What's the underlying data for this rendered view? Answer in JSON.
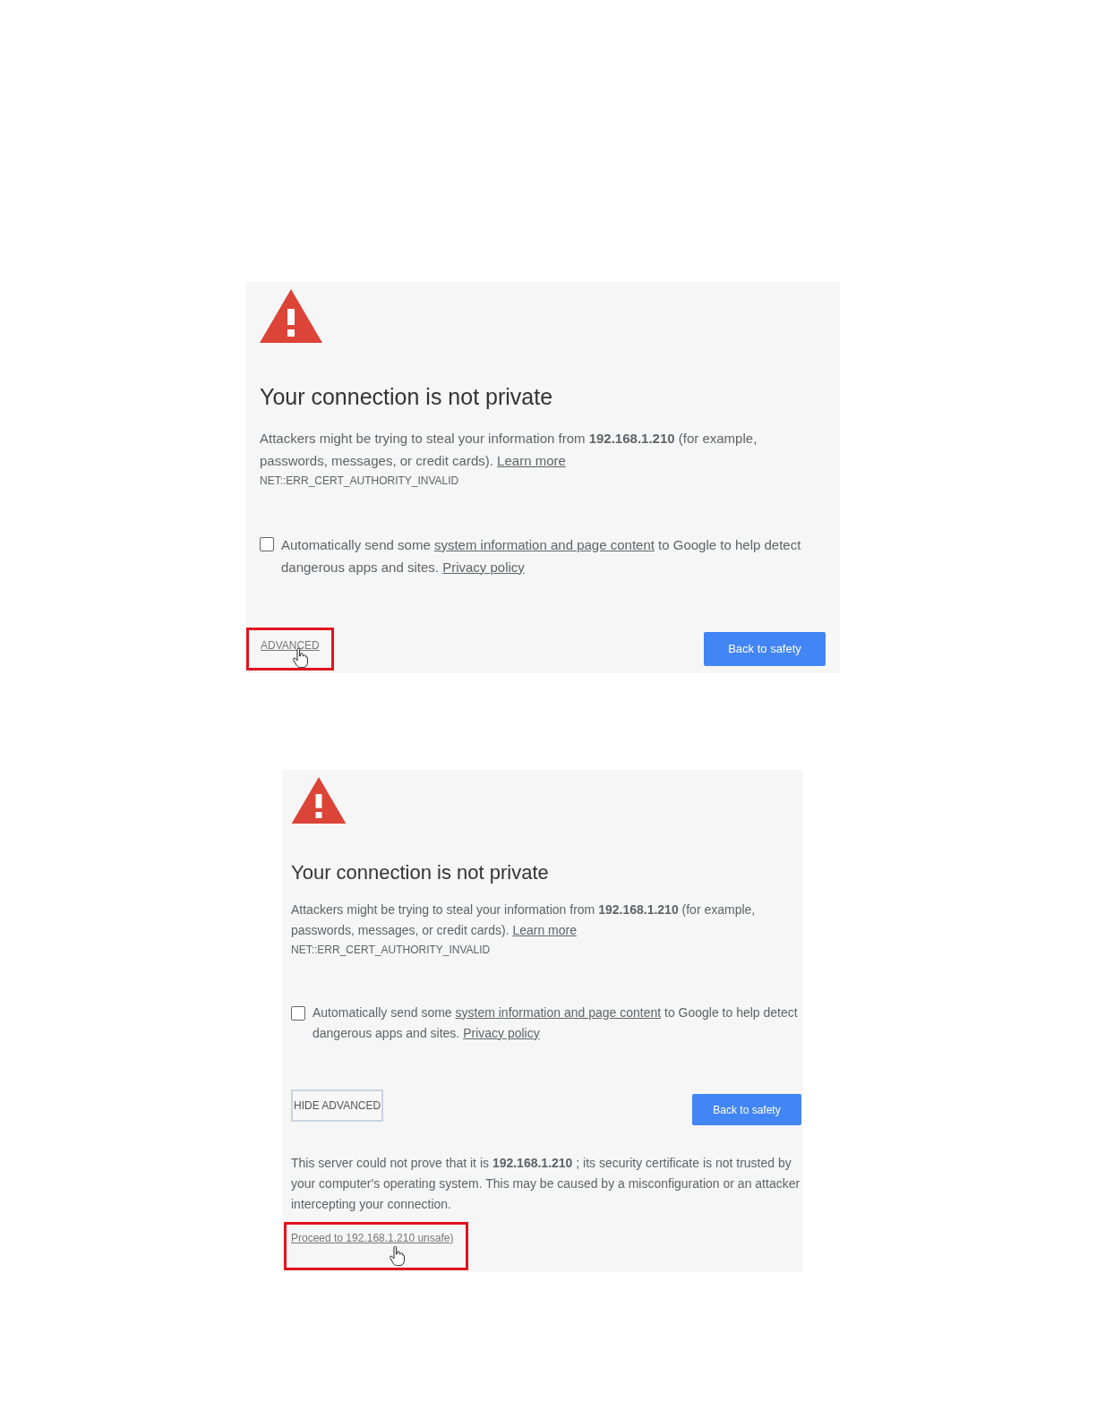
{
  "panels": [
    {
      "expanded": false,
      "toggle_highlighted": true,
      "title": "Your connection is not private",
      "message": "Attackers might be trying to steal your information from  **192.168.1.210**  (for example, passwords, messages, or credit cards).",
      "learn_more": "Learn more",
      "error_code": "NET::ERR_CERT_AUTHORITY_INVALID",
      "report": {
        "checked": false,
        "text_before": "Automatically send some",
        "link": "system information and page content",
        "text_after": "to Google to help detect dangerous apps and sites.",
        "policy_link": "Privacy policy"
      },
      "advanced_toggle": "ADVANCED",
      "primary_button": "Back to safety"
    },
    {
      "expanded": true,
      "toggle_highlighted": false,
      "proceed_highlighted": true,
      "title": "Your connection is not private",
      "message": "Attackers might be trying to steal your information from  **192.168.1.210**  (for example, passwords, messages, or credit cards).",
      "learn_more": "Learn more",
      "error_code": "NET::ERR_CERT_AUTHORITY_INVALID",
      "report": {
        "checked": false,
        "text_before": "Automatically send some",
        "link": "system information and page content",
        "text_after": "to Google to help detect dangerous apps and sites.",
        "policy_link": "Privacy policy"
      },
      "advanced_toggle": "HIDE ADVANCED",
      "primary_button": "Back to safety",
      "details": "This server could not prove that it is  **192.168.1.210**  ; its security certificate is not trusted by your computer's operating system. This may be caused by a misconfiguration or an attacker intercepting your connection.",
      "proceed_link": "Proceed to 192.168.1.210 unsafe)"
    }
  ]
}
